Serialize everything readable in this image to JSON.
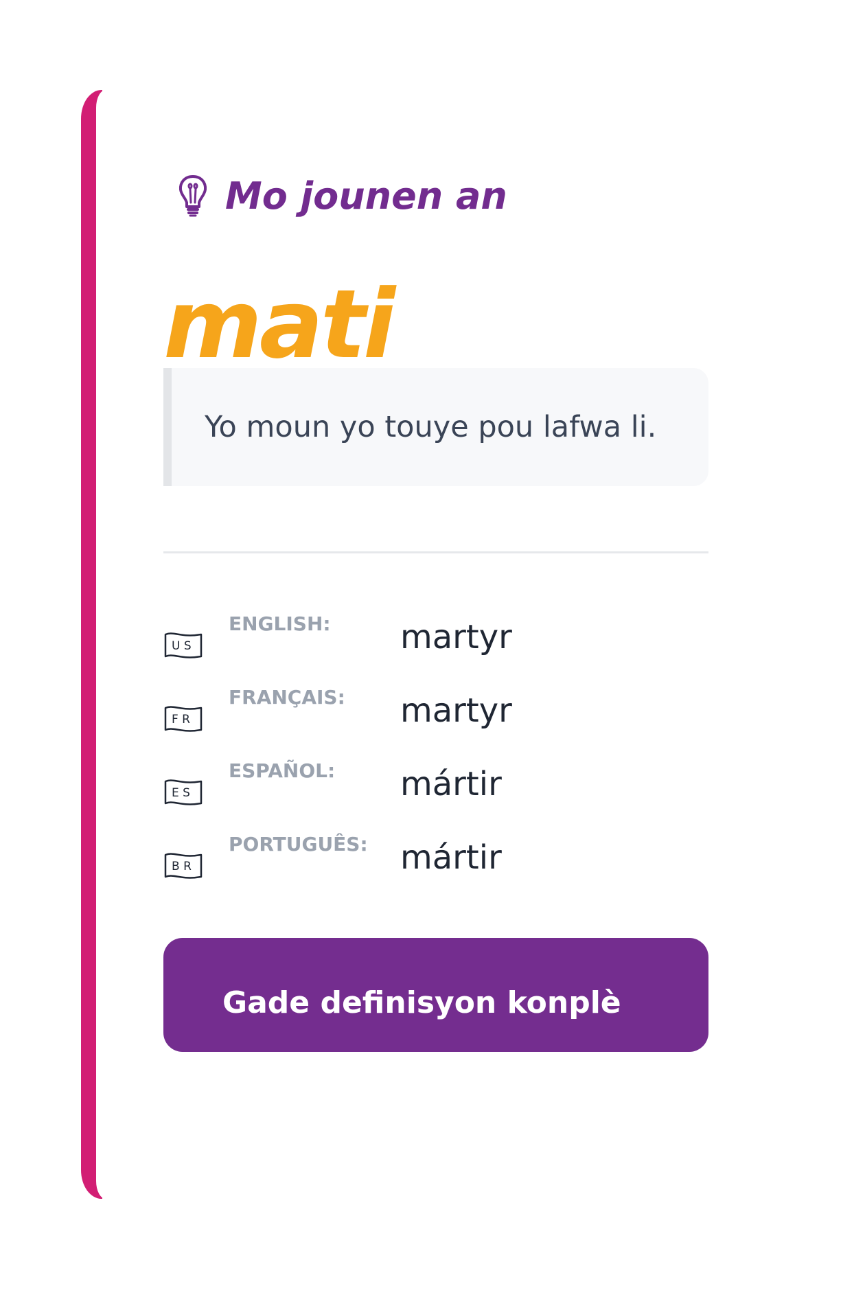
{
  "header": {
    "icon": "lightbulb-icon",
    "title": "Mo jounen an"
  },
  "word": {
    "text": "mati"
  },
  "example": {
    "sentence": "Yo moun yo touye pou lafwa li."
  },
  "translations": [
    {
      "flag": "US",
      "language": "ENGLISH:",
      "value": "martyr"
    },
    {
      "flag": "FR",
      "language": "FRANÇAIS:",
      "value": "martyr"
    },
    {
      "flag": "ES",
      "language": "ESPAÑOL:",
      "value": "mártir"
    },
    {
      "flag": "BR",
      "language": "PORTUGUÊS:",
      "value": "mártir"
    }
  ],
  "cta": {
    "label": "Gade definisyon konplè"
  },
  "colors": {
    "accent_bar": "#d21e74",
    "header": "#722c8f",
    "word": "#f6a51b",
    "button": "#742d8f"
  }
}
